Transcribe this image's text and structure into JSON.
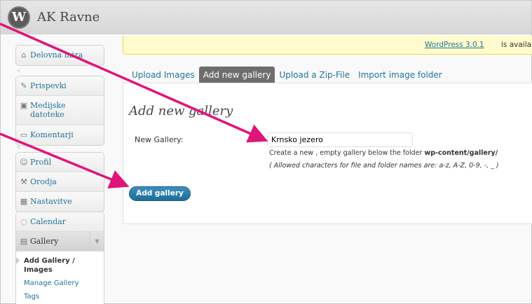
{
  "header": {
    "logo_letter": "W",
    "site_title": "AK Ravne"
  },
  "sidebar": {
    "dashboard": {
      "label": "Delovna miza",
      "icon": "home-icon"
    },
    "group1": [
      {
        "label": "Prispevki",
        "icon": "pin-icon"
      },
      {
        "label_line1": "Medijske",
        "label_line2": "datoteke",
        "icon": "media-icon"
      },
      {
        "label": "Komentarji",
        "icon": "comment-icon"
      }
    ],
    "group2": [
      {
        "label": "Profil",
        "icon": "users-icon"
      },
      {
        "label": "Orodja",
        "icon": "tools-icon"
      },
      {
        "label": "Nastavitve",
        "icon": "settings-icon"
      }
    ],
    "group3": {
      "calendar": {
        "label": "Calendar",
        "icon": "calendar-icon"
      },
      "gallery": {
        "label": "Gallery",
        "icon": "gallery-icon",
        "toggle": "▼"
      },
      "submenu": [
        {
          "label_line1": "Add Gallery /",
          "label_line2": "Images"
        },
        {
          "label": "Manage Gallery"
        },
        {
          "label": "Tags"
        }
      ]
    }
  },
  "notice": {
    "link_text": "WordPress 3.0.1",
    "rest_text": "is available"
  },
  "tabs": [
    {
      "label": "Upload Images",
      "active": false
    },
    {
      "label": "Add new gallery",
      "active": true
    },
    {
      "label": "Upload a Zip-File",
      "active": false
    },
    {
      "label": "Import image folder",
      "active": false
    }
  ],
  "form": {
    "title": "Add new gallery",
    "label": "New Gallery:",
    "value": "Krnsko jezero",
    "help_prefix": "Create a new , empty gallery below the folder",
    "help_path": "wp-content/gallery/",
    "help_allowed": "( Allowed characters for file and folder names are: a-z, A-Z, 0-9, -, _ )",
    "button": "Add gallery"
  },
  "colors": {
    "link": "#21759b",
    "arrow": "#e0157a",
    "active_tab": "#6d6d6d",
    "notice_bg": "#fffbcc"
  }
}
